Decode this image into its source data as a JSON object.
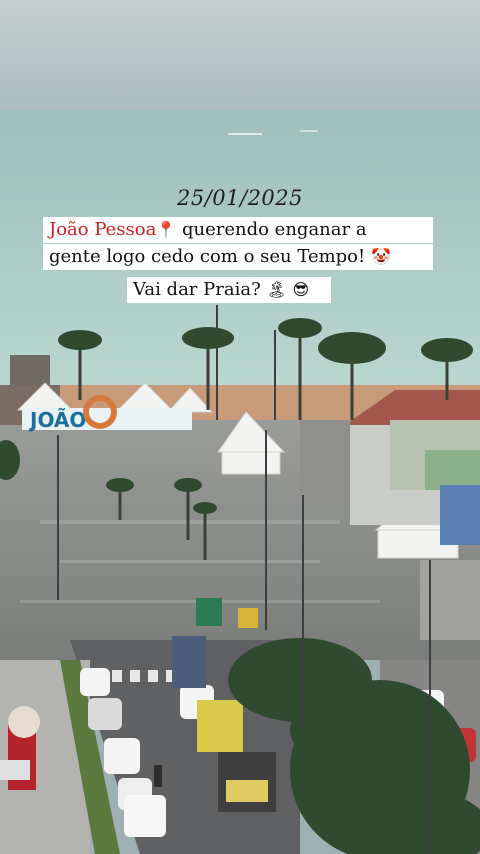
{
  "overlay": {
    "date": "25/01/2025",
    "line1_city": "João Pessoa",
    "line1_pin": "📍",
    "line1_rest": " querendo enganar a",
    "line2_text": "gente logo cedo com o seu Tempo! ",
    "line2_emoji": "🤡",
    "line3_text": "Vai dar Praia? ",
    "line3_emoji1": "🏝",
    "line3_emoji2": "😎"
  },
  "scene": {
    "sign_letters": "JOÃO",
    "colors": {
      "sky": "#b9c7c8",
      "sea": "#a6c9c3",
      "street": "#8e8f8e",
      "palm": "#2f4a2f",
      "tent": "#f3f3f1",
      "roof": "#a4574d"
    }
  }
}
